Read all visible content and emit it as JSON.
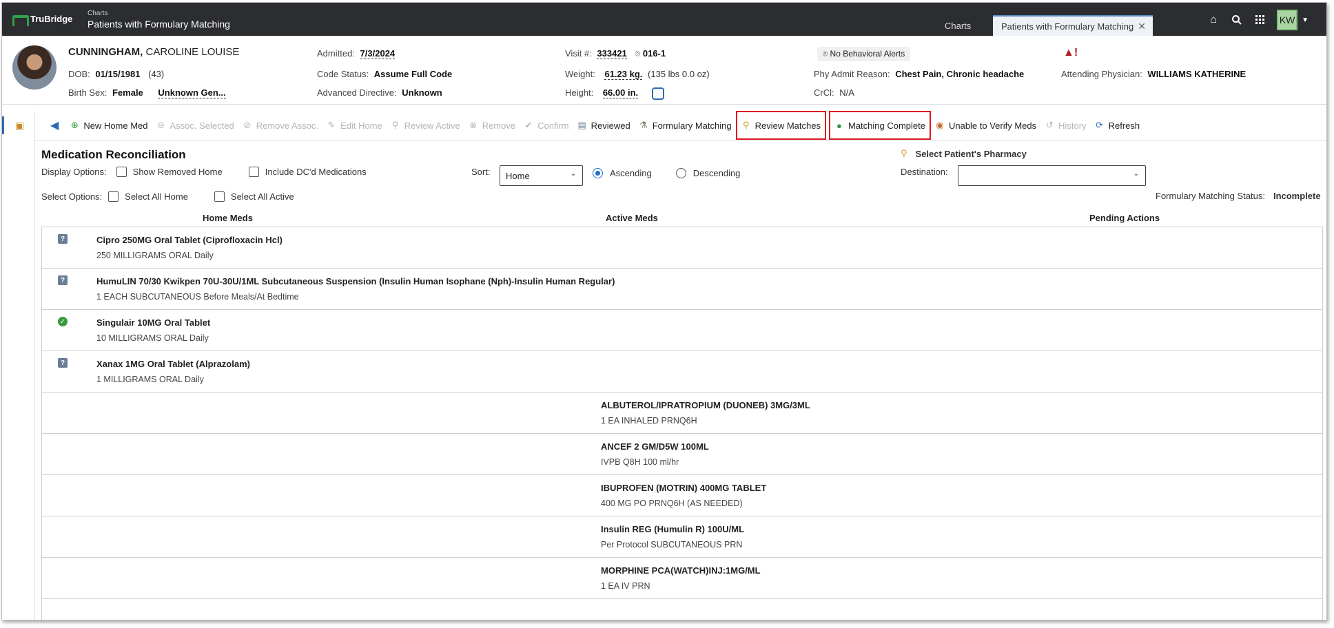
{
  "app": {
    "brand": "TruBridge",
    "crumb_small": "Charts",
    "crumb_title": "Patients with Formulary Matching",
    "tabs": [
      {
        "label": "Charts"
      },
      {
        "label": "Patients with Formulary Matching"
      }
    ],
    "user_initials": "KW"
  },
  "patient": {
    "last_name": "CUNNINGHAM,",
    "first_names": "CAROLINE LOUISE",
    "dob_label": "DOB:",
    "dob": "01/15/1981",
    "age": "(43)",
    "sex_label": "Birth Sex:",
    "sex": "Female",
    "gender": "Unknown Gen...",
    "admitted_label": "Admitted:",
    "admitted": "7/3/2024",
    "code_status_label": "Code Status:",
    "code_status": "Assume Full Code",
    "adv_dir_label": "Advanced Directive:",
    "adv_dir": "Unknown",
    "visit_label": "Visit #:",
    "visit": "333421",
    "room": "016-1",
    "weight_label": "Weight:",
    "weight": "61.23 kg.",
    "weight_lbs": "(135 lbs 0.0 oz)",
    "height_label": "Height:",
    "height": "66.00 in.",
    "behavioral_alert": "No Behavioral Alerts",
    "admit_reason_label": "Phy Admit Reason:",
    "admit_reason": "Chest Pain, Chronic headache",
    "crcl_label": "CrCl:",
    "crcl": "N/A",
    "attending_label": "Attending Physician:",
    "attending": "WILLIAMS KATHERINE"
  },
  "toolbar": {
    "new_home_med": "New Home Med",
    "assoc_selected": "Assoc. Selected",
    "remove_assoc": "Remove Assoc.",
    "edit_home": "Edit Home",
    "review_active": "Review Active",
    "remove": "Remove",
    "confirm": "Confirm",
    "reviewed": "Reviewed",
    "formulary_matching": "Formulary Matching",
    "review_matches": "Review Matches",
    "matching_complete": "Matching Complete",
    "unable_verify": "Unable to Verify Meds",
    "history": "History",
    "refresh": "Refresh"
  },
  "medrec": {
    "title": "Medication Reconciliation",
    "display_options_label": "Display Options:",
    "show_removed_home": "Show Removed Home",
    "include_dc": "Include DC'd Medications",
    "sort_label": "Sort:",
    "sort_value": "Home",
    "ascending": "Ascending",
    "descending": "Descending",
    "select_pharmacy": "Select Patient's Pharmacy",
    "destination_label": "Destination:",
    "destination_value": "",
    "select_options_label": "Select Options:",
    "select_all_home": "Select All Home",
    "select_all_active": "Select All Active",
    "fm_status_label": "Formulary Matching Status:",
    "fm_status": "Incomplete",
    "col_home": "Home Meds",
    "col_active": "Active Meds",
    "col_pending": "Pending Actions"
  },
  "home_meds": [
    {
      "name": "Cipro 250MG Oral Tablet (Ciprofloxacin Hcl)",
      "sig": "250 MILLIGRAMS ORAL Daily",
      "status": "question"
    },
    {
      "name": "HumuLIN 70/30 Kwikpen 70U-30U/1ML Subcutaneous Suspension (Insulin Human Isophane (Nph)-Insulin Human Regular)",
      "sig": "1 EACH SUBCUTANEOUS Before Meals/At Bedtime",
      "status": "question"
    },
    {
      "name": "Singulair 10MG Oral Tablet",
      "sig": "10 MILLIGRAMS ORAL Daily",
      "status": "matched"
    },
    {
      "name": "Xanax 1MG Oral Tablet (Alprazolam)",
      "sig": "1 MILLIGRAMS ORAL Daily",
      "status": "question"
    }
  ],
  "active_meds": [
    {
      "name": "ALBUTEROL/IPRATROPIUM (DUONEB) 3MG/3ML",
      "sig": "1 EA INHALED PRNQ6H"
    },
    {
      "name": "ANCEF 2 GM/D5W 100ML",
      "sig": "IVPB Q8H 100 ml/hr"
    },
    {
      "name": "IBUPROFEN (MOTRIN) 400MG TABLET",
      "sig": "400 MG PO PRNQ6H (AS NEEDED)"
    },
    {
      "name": "Insulin REG (Humulin R) 100U/ML",
      "sig": "Per Protocol SUBCUTANEOUS PRN"
    },
    {
      "name": "MORPHINE PCA(WATCH)INJ:1MG/ML",
      "sig": "1 EA IV PRN"
    }
  ],
  "colors": {
    "topbar": "#2b2d30",
    "brand_green": "#2fa24b",
    "highlight_red": "#e0171f",
    "accent_blue": "#1f6fc5"
  }
}
